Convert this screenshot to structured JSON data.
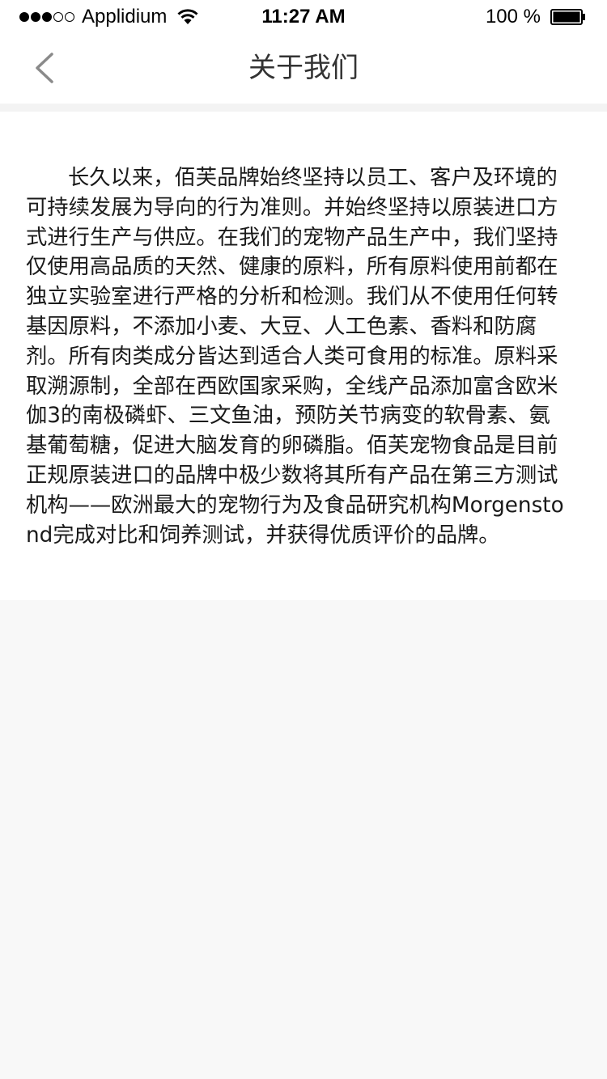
{
  "status_bar": {
    "carrier": "Applidium",
    "time": "11:27 AM",
    "battery": "100 %",
    "signal_bars": 3,
    "signal_total": 5
  },
  "nav": {
    "title": "关于我们",
    "back_icon": "chevron-left-icon"
  },
  "content": {
    "about_text": "长久以来，佰芙品牌始终坚持以员工、客户及环境的可持续发展为导向的行为准则。并始终坚持以原装进口方式进行生产与供应。在我们的宠物产品生产中，我们坚持仅使用高品质的天然、健康的原料，所有原料使用前都在独立实验室进行严格的分析和检测。我们从不使用任何转基因原料，不添加小麦、大豆、人工色素、香料和防腐剂。所有肉类成分皆达到适合人类可食用的标准。原料采取溯源制，全部在西欧国家采购，全线产品添加富含欧米伽3的南极磷虾、三文鱼油，预防关节病变的软骨素、氨基葡萄糖，促进大脑发育的卵磷脂。佰芙宠物食品是目前正规原装进口的品牌中极少数将其所有产品在第三方测试机构——欧洲最大的宠物行为及食品研究机构Morgenstond完成对比和饲养测试，并获得优质评价的品牌。"
  },
  "colors": {
    "page_background": "#f8f8f8",
    "card_background": "#ffffff",
    "title_color": "#333333",
    "text_color": "#1a1a1a",
    "back_icon_color": "#8a8a8a"
  }
}
